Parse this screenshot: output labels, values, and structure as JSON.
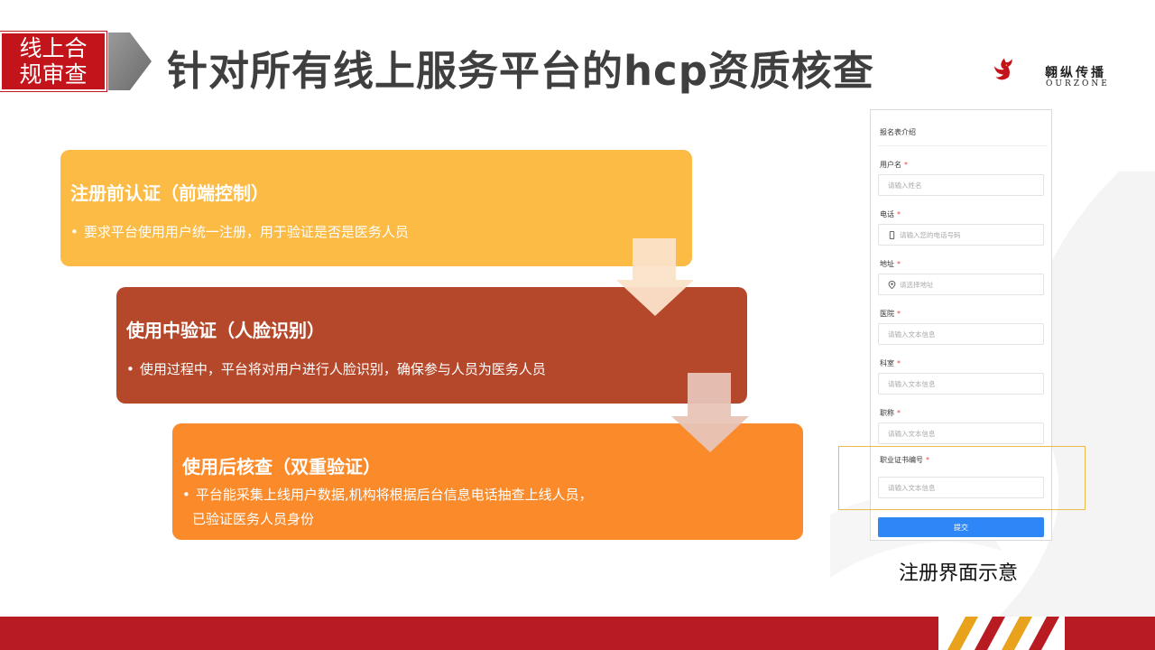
{
  "header": {
    "tag_line1": "线上合",
    "tag_line2": "规审查",
    "title": "针对所有线上服务平台的hcp资质核查"
  },
  "logo": {
    "name_cn": "翱纵传播",
    "name_en": "OURZONE"
  },
  "steps": [
    {
      "title": "注册前认证（前端控制）",
      "bullet_lines": [
        "要求平台使用用户统一注册，用于验证是否是医务人员"
      ],
      "color": "#fcbb44"
    },
    {
      "title": "使用中验证（人脸识别）",
      "bullet_lines": [
        "使用过程中，平台将对用户进行人脸识别，确保参与人员为医务人员"
      ],
      "color": "#b5482a"
    },
    {
      "title": "使用后核查（双重验证）",
      "bullet_lines": [
        "平台能采集上线用户数据,机构将根据后台信息电话抽查上线人员，",
        "已验证医务人员身份"
      ],
      "color": "#fb8a2a"
    }
  ],
  "form": {
    "intro": "报名表介绍",
    "fields": [
      {
        "label": "用户名",
        "placeholder": "请输入姓名",
        "icon": "none"
      },
      {
        "label": "电话",
        "placeholder": "请输入您的电话号码",
        "icon": "phone-icon"
      },
      {
        "label": "地址",
        "placeholder": "请选择地址",
        "icon": "location-pin-icon"
      },
      {
        "label": "医院",
        "placeholder": "请输入文本信息",
        "icon": "none"
      },
      {
        "label": "科室",
        "placeholder": "请输入文本信息",
        "icon": "none"
      },
      {
        "label": "职称",
        "placeholder": "请输入文本信息",
        "icon": "none"
      },
      {
        "label": "职业证书编号",
        "placeholder": "请输入文本信息",
        "icon": "none"
      }
    ],
    "required_mark": "*",
    "submit_label": "提交",
    "accent_color": "#2f86f6"
  },
  "caption": "注册界面示意",
  "colors": {
    "brand_red": "#c4141b",
    "bottom_bar": "#b81c22",
    "stripe_gold": "#e8a21b"
  }
}
